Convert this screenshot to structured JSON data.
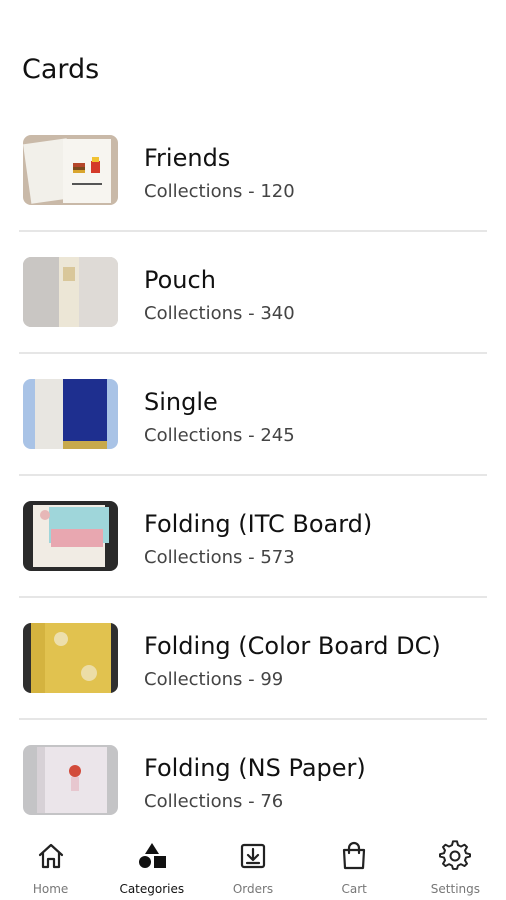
{
  "header": {
    "title": "Cards"
  },
  "categories": [
    {
      "name": "Friends",
      "collections": "Collections - 120",
      "thumb_icon": "friends-card-thumbnail"
    },
    {
      "name": "Pouch",
      "collections": "Collections - 340",
      "thumb_icon": "pouch-card-thumbnail"
    },
    {
      "name": "Single",
      "collections": "Collections - 245",
      "thumb_icon": "single-card-thumbnail"
    },
    {
      "name": "Folding (ITC Board)",
      "collections": "Collections - 573",
      "thumb_icon": "folding-itc-card-thumbnail"
    },
    {
      "name": "Folding (Color Board DC)",
      "collections": "Collections - 99",
      "thumb_icon": "folding-color-board-card-thumbnail"
    },
    {
      "name": "Folding (NS Paper)",
      "collections": "Collections - 76",
      "thumb_icon": "folding-ns-paper-card-thumbnail"
    }
  ],
  "bottom_nav": {
    "items": [
      {
        "label": "Home",
        "icon": "home-icon",
        "active": false
      },
      {
        "label": "Categories",
        "icon": "categories-icon",
        "active": true
      },
      {
        "label": "Orders",
        "icon": "orders-icon",
        "active": false
      },
      {
        "label": "Cart",
        "icon": "cart-icon",
        "active": false
      },
      {
        "label": "Settings",
        "icon": "settings-icon",
        "active": false
      }
    ]
  },
  "colors": {
    "divider": "#e6e6e6",
    "text": "#111111",
    "subtext": "#444444",
    "nav_inactive": "#777777"
  }
}
